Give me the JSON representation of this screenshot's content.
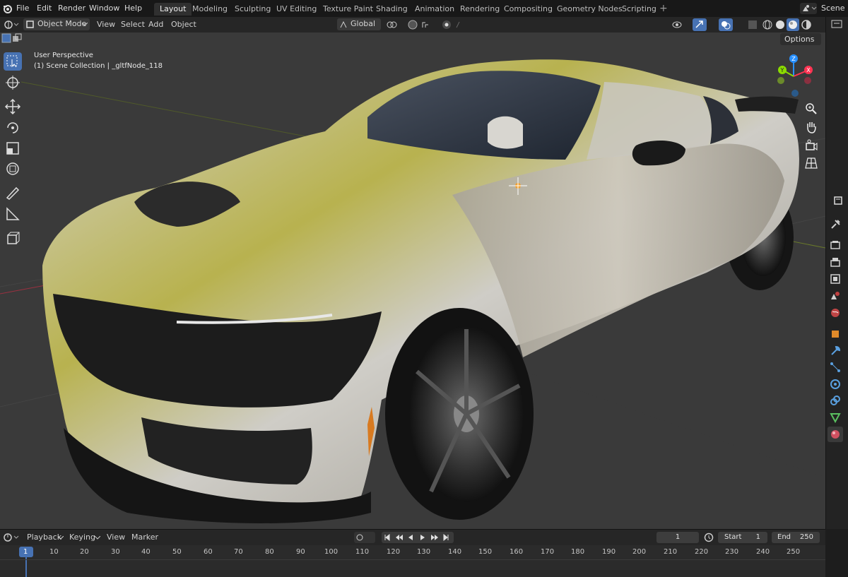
{
  "menu": {
    "items": [
      "File",
      "Edit",
      "Render",
      "Window",
      "Help"
    ]
  },
  "workspaces": {
    "active": "Layout",
    "tabs": [
      "Layout",
      "Modeling",
      "Sculpting",
      "UV Editing",
      "Texture Paint",
      "Shading",
      "Animation",
      "Rendering",
      "Compositing",
      "Geometry Nodes",
      "Scripting"
    ],
    "add": "+"
  },
  "scene": {
    "name": "Scene"
  },
  "header": {
    "mode": "Object Mode",
    "view": "View",
    "select": "Select",
    "add": "Add",
    "object": "Object",
    "orientation": "Global",
    "options": "Options"
  },
  "viewport": {
    "perspective": "User Perspective",
    "collection": "(1) Scene Collection | _gltfNode_118",
    "gizmo": {
      "x": "X",
      "y": "Y",
      "z": "Z"
    }
  },
  "timeline": {
    "playback": "Playback",
    "keying": "Keying",
    "view": "View",
    "marker": "Marker",
    "current_frame": "1",
    "start_label": "Start",
    "start": "1",
    "end_label": "End",
    "end": "250",
    "ticks": [
      "1",
      "10",
      "20",
      "30",
      "40",
      "50",
      "60",
      "70",
      "80",
      "90",
      "100",
      "110",
      "120",
      "130",
      "140",
      "150",
      "160",
      "170",
      "180",
      "190",
      "200",
      "210",
      "220",
      "230",
      "240",
      "250"
    ]
  },
  "colors": {
    "accent": "#4772b3",
    "axis_x": "#ff3352",
    "axis_y": "#8bdc00",
    "axis_z": "#2890ff",
    "car_body": "#bdb9b0"
  }
}
